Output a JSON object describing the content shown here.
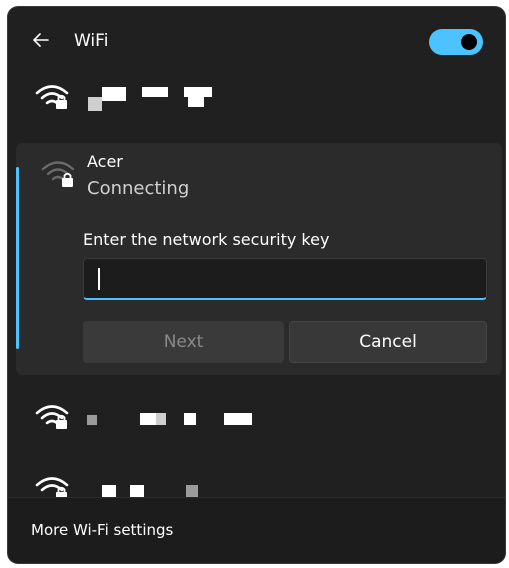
{
  "header": {
    "back_icon": "arrow-left-icon",
    "title": "WiFi",
    "toggle_state": "on",
    "accent_color": "#4cc2ff"
  },
  "networks": {
    "top": {
      "icon": "wifi-locked-icon"
    },
    "expanded": {
      "icon": "wifi-locked-icon",
      "name": "Acer",
      "status": "Connecting",
      "key_label": "Enter the network security key",
      "key_value": "",
      "next_label": "Next",
      "cancel_label": "Cancel"
    },
    "below": [
      {
        "icon": "wifi-locked-icon"
      },
      {
        "icon": "wifi-locked-icon"
      }
    ]
  },
  "footer": {
    "link_label": "More Wi-Fi settings"
  }
}
